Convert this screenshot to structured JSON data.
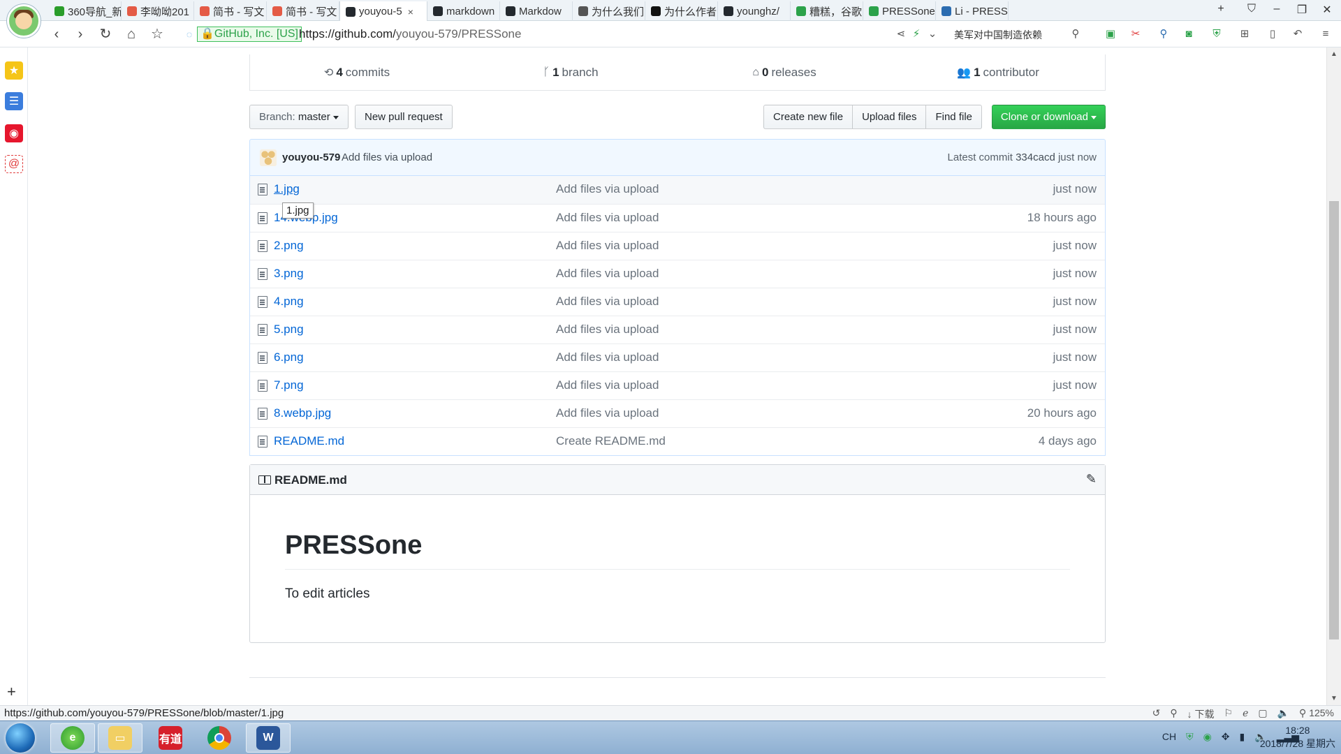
{
  "browser": {
    "tabs": [
      {
        "title": "360导航_新",
        "icon_color": "#2a9d2a",
        "icon": "360-icon"
      },
      {
        "title": "李呦呦201",
        "icon_color": "#e45b46",
        "icon": "jianshu-icon"
      },
      {
        "title": "简书 - 写文",
        "icon_color": "#e45b46",
        "icon": "jianshu-icon"
      },
      {
        "title": "简书 - 写文",
        "icon_color": "#e45b46",
        "icon": "jianshu-icon"
      },
      {
        "title": "youyou-5",
        "icon_color": "#24292e",
        "icon": "github-icon",
        "active": true
      },
      {
        "title": "markdown",
        "icon_color": "#24292e",
        "icon": "github-icon"
      },
      {
        "title": "Markdow",
        "icon_color": "#24292e",
        "icon": "markdown-icon"
      },
      {
        "title": "为什么我们",
        "icon_color": "#555555",
        "icon": "zhihu-icon"
      },
      {
        "title": "为什么作者",
        "icon_color": "#111111",
        "icon": "t-icon"
      },
      {
        "title": "younghz/",
        "icon_color": "#24292e",
        "icon": "github-icon"
      },
      {
        "title": "糟糕，谷歌",
        "icon_color": "#2ca24a",
        "icon": "e-icon"
      },
      {
        "title": "PRESSone",
        "icon_color": "#2ca24a",
        "icon": "wechat-icon"
      },
      {
        "title": "Li - PRESS",
        "icon_color": "#2b6cb0",
        "icon": "loading-icon"
      }
    ],
    "tab_close": "×",
    "new_tab": "+",
    "cert_label": "GitHub, Inc. [US]",
    "url_base": "https://github.com/",
    "url_path": "youyou-579/PRESSone",
    "news_text": "美军对中国制造依赖"
  },
  "repo": {
    "commits_count": "4",
    "commits_label": "commits",
    "branch_count": "1",
    "branch_label": "branch",
    "releases_count": "0",
    "releases_label": "releases",
    "contributor_count": "1",
    "contributor_label": "contributor"
  },
  "filebar": {
    "branch_prefix": "Branch:",
    "branch_name": "master",
    "new_pr": "New pull request",
    "create_file": "Create new file",
    "upload_files": "Upload files",
    "find_file": "Find file",
    "clone": "Clone or download"
  },
  "commit": {
    "author": "youyou-579",
    "message": "Add files via upload",
    "latest_label": "Latest commit",
    "sha": "334cacd",
    "time": "just now"
  },
  "files": [
    {
      "name": "1.jpg",
      "message": "Add files via upload",
      "age": "just now"
    },
    {
      "name": "14.webp.jpg",
      "message": "Add files via upload",
      "age": "18 hours ago"
    },
    {
      "name": "2.png",
      "message": "Add files via upload",
      "age": "just now"
    },
    {
      "name": "3.png",
      "message": "Add files via upload",
      "age": "just now"
    },
    {
      "name": "4.png",
      "message": "Add files via upload",
      "age": "just now"
    },
    {
      "name": "5.png",
      "message": "Add files via upload",
      "age": "just now"
    },
    {
      "name": "6.png",
      "message": "Add files via upload",
      "age": "just now"
    },
    {
      "name": "7.png",
      "message": "Add files via upload",
      "age": "just now"
    },
    {
      "name": "8.webp.jpg",
      "message": "Add files via upload",
      "age": "20 hours ago"
    },
    {
      "name": "README.md",
      "message": "Create README.md",
      "age": "4 days ago"
    }
  ],
  "tooltip": "1.jpg",
  "readme": {
    "filename": "README.md",
    "heading": "PRESSone",
    "body": "To edit articles"
  },
  "statusbar": {
    "hover_url": "https://github.com/youyou-579/PRESSone/blob/master/1.jpg",
    "download_label": "下载",
    "zoom": "125%"
  },
  "taskbar": {
    "lang": "CH",
    "time": "18:28",
    "date": "2018/7/28 星期六",
    "youdao_label": "有道",
    "word_label": "W"
  }
}
